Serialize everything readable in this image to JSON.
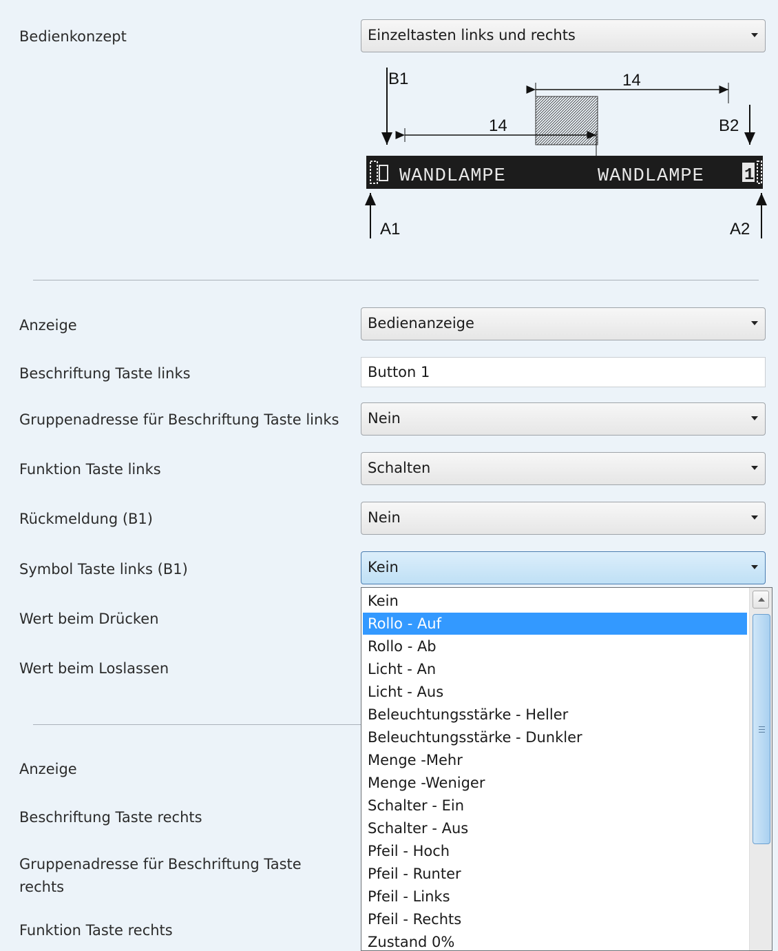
{
  "form": {
    "bedienkonzept": {
      "label": "Bedienkonzept",
      "value": "Einzeltasten links und rechts"
    },
    "anzeige_links": {
      "label": "Anzeige",
      "value": "Bedienanzeige"
    },
    "beschriftung_links": {
      "label": "Beschriftung Taste links",
      "value": "Button 1"
    },
    "gruppenadresse_links": {
      "label": "Gruppenadresse für Beschriftung Taste links",
      "value": "Nein"
    },
    "funktion_links": {
      "label": "Funktion Taste links",
      "value": "Schalten"
    },
    "rueckmeldung": {
      "label": "Rückmeldung (B1)",
      "value": "Nein"
    },
    "symbol_links": {
      "label": "Symbol Taste links (B1)",
      "value": "Kein"
    },
    "wert_druecken": {
      "label": "Wert beim Drücken"
    },
    "wert_loslassen": {
      "label": "Wert beim Loslassen"
    },
    "anzeige_rechts": {
      "label": "Anzeige"
    },
    "beschriftung_rechts": {
      "label": "Beschriftung Taste rechts"
    },
    "gruppenadresse_rechts": {
      "label_line1": "Gruppenadresse für Beschriftung Taste",
      "label_line2": "rechts"
    },
    "funktion_rechts": {
      "label": "Funktion Taste rechts"
    }
  },
  "diagram": {
    "label_b1": "B1",
    "label_b2": "B2",
    "label_a1": "A1",
    "label_a2": "A2",
    "dim_top": "14",
    "dim_mid": "14",
    "display_left": "WANDLAMPE",
    "display_right": "WANDLAMPE",
    "display_right_digit": "1"
  },
  "dropdown": {
    "selected": "Rollo - Auf",
    "options": [
      "Kein",
      "Rollo - Auf",
      "Rollo - Ab",
      "Licht - An",
      "Licht - Aus",
      "Beleuchtungsstärke - Heller",
      "Beleuchtungsstärke - Dunkler",
      "Menge -Mehr",
      "Menge -Weniger",
      "Schalter - Ein",
      "Schalter - Aus",
      "Pfeil - Hoch",
      "Pfeil - Runter",
      "Pfeil - Links",
      "Pfeil - Rechts",
      "Zustand 0%"
    ]
  },
  "icons": {
    "combo_arrow": "chevron-down-icon",
    "scroll_up": "scroll-up-icon"
  },
  "colors": {
    "background": "#ecf3f9",
    "selection": "#3399ff",
    "display": "#1c1c1c"
  }
}
